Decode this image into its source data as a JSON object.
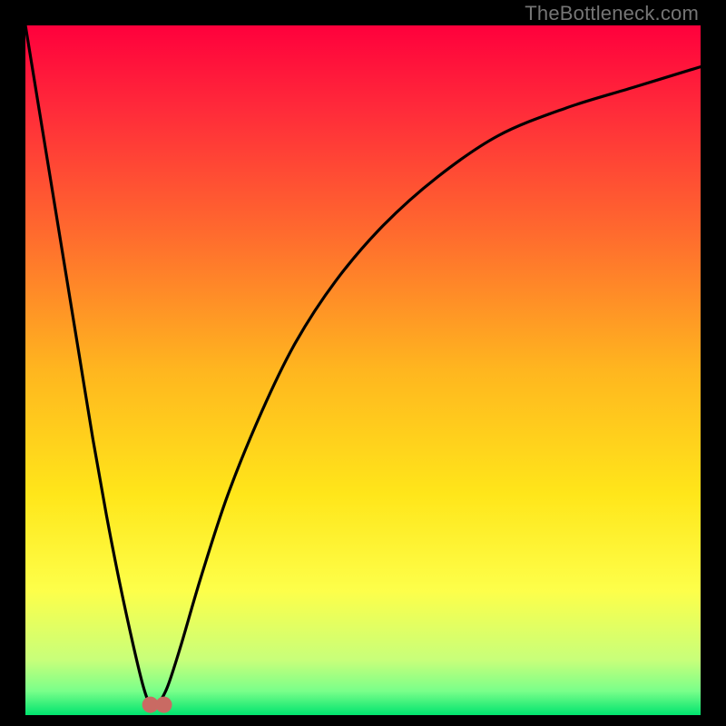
{
  "watermark": "TheBottleneck.com",
  "chart_data": {
    "type": "line",
    "title": "",
    "xlabel": "",
    "ylabel": "",
    "xlim": [
      0,
      100
    ],
    "ylim": [
      0,
      100
    ],
    "series": [
      {
        "name": "bottleneck-curve",
        "x": [
          0,
          2,
          4,
          6,
          8,
          10,
          12,
          14,
          16,
          17.5,
          18.5,
          19.5,
          21,
          23,
          26,
          30,
          35,
          40,
          46,
          53,
          61,
          70,
          80,
          90,
          100
        ],
        "values": [
          100,
          88,
          76,
          64,
          52,
          40,
          29,
          19,
          10,
          4,
          1.5,
          1.5,
          4,
          10,
          20,
          32,
          44,
          54,
          63,
          71,
          78,
          84,
          88,
          91,
          94
        ]
      }
    ],
    "background_gradient": {
      "stops": [
        {
          "offset": 0.0,
          "color": "#ff003c"
        },
        {
          "offset": 0.12,
          "color": "#ff2a3a"
        },
        {
          "offset": 0.3,
          "color": "#ff6a2e"
        },
        {
          "offset": 0.5,
          "color": "#ffb61f"
        },
        {
          "offset": 0.68,
          "color": "#ffe61a"
        },
        {
          "offset": 0.82,
          "color": "#fdff4a"
        },
        {
          "offset": 0.92,
          "color": "#c8ff7a"
        },
        {
          "offset": 0.965,
          "color": "#7aff8a"
        },
        {
          "offset": 1.0,
          "color": "#00e36e"
        }
      ]
    },
    "markers": [
      {
        "name": "min-left",
        "x": 18.5,
        "y": 1.5,
        "r": 9,
        "color": "#c96a63"
      },
      {
        "name": "min-right",
        "x": 20.5,
        "y": 1.5,
        "r": 9,
        "color": "#c96a63"
      }
    ]
  }
}
